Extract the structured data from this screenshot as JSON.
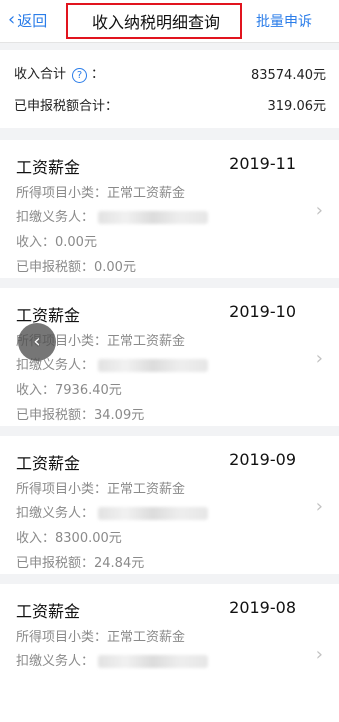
{
  "header": {
    "back_label": "返回",
    "title": "收入纳税明细查询",
    "batch_label": "批量申诉",
    "accent": "#2b7de9",
    "highlight": "#e1141e"
  },
  "summary": {
    "income_label": "收入合计",
    "income_colon": "：",
    "income_value": "83574.40元",
    "tax_label": "已申报税额合计：",
    "tax_value": "319.06元"
  },
  "records": [
    {
      "type": "工资薪金",
      "period": "2019-11",
      "subtype_line": "所得项目小类：正常工资薪金",
      "withholder_label": "扣缴义务人：",
      "income_line": "收入：0.00元",
      "tax_line": "已申报税额：0.00元"
    },
    {
      "type": "工资薪金",
      "period": "2019-10",
      "subtype_line": "所得项目小类：正常工资薪金",
      "withholder_label": "扣缴义务人：",
      "income_line": "收入：7936.40元",
      "tax_line": "已申报税额：34.09元"
    },
    {
      "type": "工资薪金",
      "period": "2019-09",
      "subtype_line": "所得项目小类：正常工资薪金",
      "withholder_label": "扣缴义务人：",
      "income_line": "收入：8300.00元",
      "tax_line": "已申报税额：24.84元"
    },
    {
      "type": "工资薪金",
      "period": "2019-08",
      "subtype_line": "所得项目小类：正常工资薪金",
      "withholder_label": "扣缴义务人：",
      "income_line": "",
      "tax_line": ""
    }
  ],
  "icons": {
    "back": "chevron-left-icon",
    "help": "question-circle-icon",
    "row_arrow": "chevron-right-icon",
    "floating_back": "floating-back-icon"
  }
}
